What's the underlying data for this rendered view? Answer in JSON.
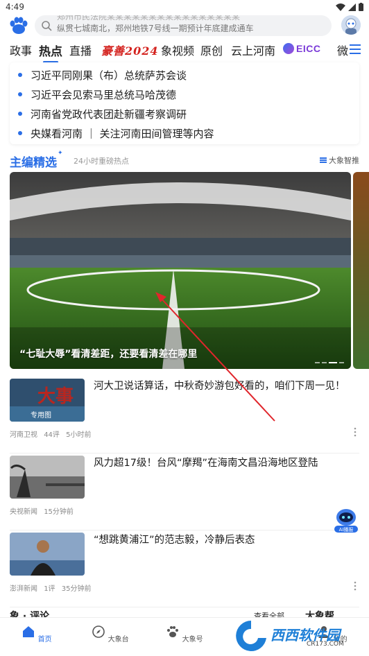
{
  "status_bar": {
    "time": "4:49"
  },
  "search": {
    "ticker_line_1": "郑州市民法院某某某某某某某某某某某某某某某某",
    "ticker_line_2": "纵贯七城南北，郑州地铁7号线一期预计年底建成通车"
  },
  "tabs": [
    {
      "label": "政事"
    },
    {
      "label": "热点",
      "active": true
    },
    {
      "label": "直播"
    },
    {
      "label": "豪善2024",
      "style": "brand-script"
    },
    {
      "label": "象视频"
    },
    {
      "label": "原创"
    },
    {
      "label": "云上河南"
    },
    {
      "label": "EICC",
      "style": "logo"
    },
    {
      "label": "微"
    }
  ],
  "headlines": [
    "习近平同刚果（布）总统萨苏会谈",
    "习近平会见索马里总统马哈茂德",
    "河南省党政代表团赴新疆考察调研",
    "央媒看河南 ｜ 关注河南田间管理等内容"
  ],
  "picks": {
    "title": "主编精选",
    "subtitle": "24小时重磅热点",
    "ai_label": "大象智推"
  },
  "hero": {
    "caption": "“七耻大辱”看清差距，还要看清差在哪里"
  },
  "news": [
    {
      "title": "河大卫说话算话，中秋奇妙游包好看的，咱们下周一见！",
      "source": "河南卫视",
      "count": "44评",
      "time": "5小时前",
      "thumb_text": "大事",
      "thumb_sub": "专用图"
    },
    {
      "title": "风力超17级！台风“摩羯”在海南文昌沿海地区登陆",
      "source": "央视新闻",
      "count": "",
      "time": "15分钟前"
    },
    {
      "title": "“想跳黄浦江”的范志毅，冷静后表态",
      "source": "澎湃新闻",
      "count": "1评",
      "time": "35分钟前"
    }
  ],
  "comment_section": {
    "title": "象 · 评论",
    "more": "查看全部",
    "right_title": "大象帮"
  },
  "ai_float_label": "AI播报",
  "bottom_nav": [
    {
      "label": "首页",
      "active": true,
      "icon": "home-icon"
    },
    {
      "label": "大象台",
      "icon": "compass-icon"
    },
    {
      "label": "大象号",
      "icon": "paw-icon"
    },
    {
      "label": "",
      "icon": "watermark"
    },
    {
      "label": "我的",
      "icon": "user-icon"
    }
  ],
  "watermark": {
    "text": "西西软件园",
    "sub": "CR173.COM"
  },
  "colors": {
    "accent": "#2a6ee6",
    "brand_red": "#d4231f"
  }
}
